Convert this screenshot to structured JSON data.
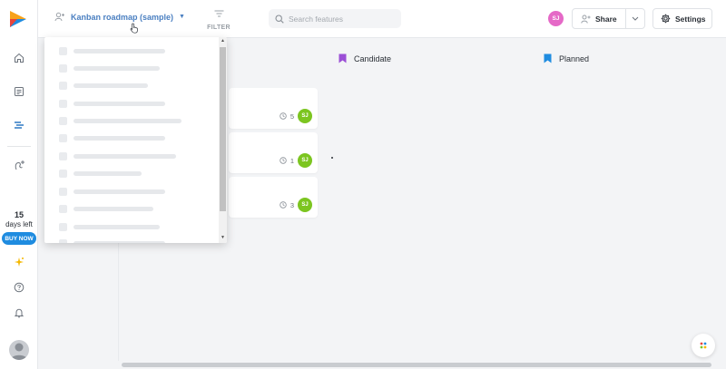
{
  "topbar": {
    "roadmap_title": "Kanban roadmap (sample)",
    "filter_label": "FILTER",
    "search_placeholder": "Search features",
    "user_initials": "SJ",
    "share_label": "Share",
    "settings_label": "Settings"
  },
  "sidebar": {
    "trial_days": "15",
    "trial_label": "days left",
    "buy_label": "BUY NOW"
  },
  "columns": [
    {
      "label": "Candidate",
      "color": "#9b4fd6"
    },
    {
      "label": "Planned",
      "color": "#1f8ce0"
    }
  ],
  "cards": [
    {
      "count": "5",
      "initials": "SJ"
    },
    {
      "count": "1",
      "initials": "SJ"
    },
    {
      "count": "3",
      "initials": "SJ"
    }
  ],
  "colors": {
    "accent": "#4a7fc1",
    "buy_button": "#1f8ce0",
    "user_avatar": "#e569c7",
    "card_avatar": "#7cc520"
  },
  "icons": [
    "logo-icon",
    "home-icon",
    "document-icon",
    "roadmap-icon",
    "add-idea-icon",
    "sparkle-icon",
    "help-icon",
    "bell-icon",
    "filter-icon",
    "search-icon",
    "share-person-icon",
    "gear-icon",
    "clock-icon",
    "apps-icon"
  ]
}
